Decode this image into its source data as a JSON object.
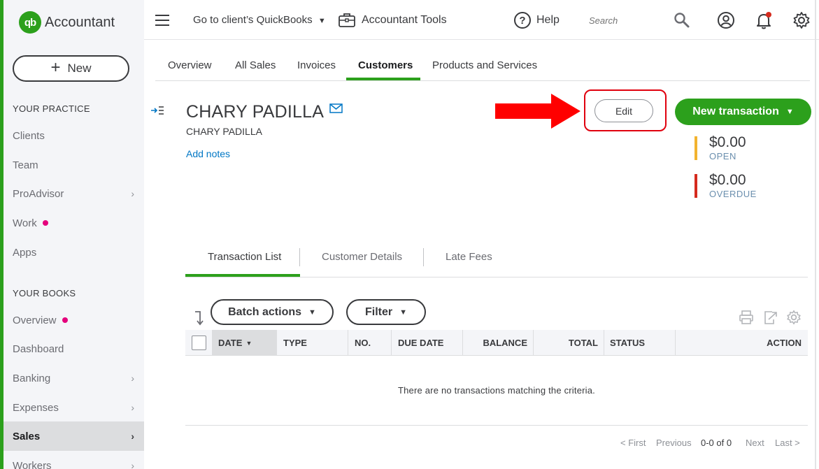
{
  "brand": {
    "logo_text": "qb",
    "name": "Accountant"
  },
  "sidebar": {
    "new_label": "New",
    "practice_heading": "YOUR PRACTICE",
    "practice_items": [
      {
        "label": "Clients"
      },
      {
        "label": "Team"
      },
      {
        "label": "ProAdvisor"
      },
      {
        "label": "Work"
      },
      {
        "label": "Apps"
      }
    ],
    "books_heading": "YOUR BOOKS",
    "books_items": [
      {
        "label": "Overview"
      },
      {
        "label": "Dashboard"
      },
      {
        "label": "Banking"
      },
      {
        "label": "Expenses"
      },
      {
        "label": "Sales"
      },
      {
        "label": "Workers"
      }
    ],
    "notification_dot_color": "#e4007c",
    "accent_color": "#2ca01c"
  },
  "topbar": {
    "client_dropdown": "Go to client’s QuickBooks",
    "accountant_tools": "Accountant Tools",
    "help_label": "Help",
    "search_placeholder": "Search"
  },
  "page_tabs": [
    "Overview",
    "All Sales",
    "Invoices",
    "Customers",
    "Products and Services"
  ],
  "customer": {
    "name": "CHARY PADILLA",
    "subtitle": "CHARY PADILLA",
    "add_notes": "Add notes",
    "edit_label": "Edit",
    "new_transaction_label": "New transaction",
    "open_amount": "$0.00",
    "open_label": "OPEN",
    "open_color": "#f2b32f",
    "overdue_amount": "$0.00",
    "overdue_label": "OVERDUE",
    "overdue_color": "#d52b1e"
  },
  "sub_tabs": [
    "Transaction List",
    "Customer Details",
    "Late Fees"
  ],
  "toolbar": {
    "batch_actions": "Batch actions",
    "filter": "Filter"
  },
  "table": {
    "columns": [
      "DATE",
      "TYPE",
      "NO.",
      "DUE DATE",
      "BALANCE",
      "TOTAL",
      "STATUS",
      "ACTION"
    ],
    "sorted_column": "DATE",
    "empty_message": "There are no transactions matching the criteria."
  },
  "pagination": {
    "first": "< First",
    "previous": "Previous",
    "count": "0-0 of 0",
    "next": "Next",
    "last": "Last >"
  }
}
